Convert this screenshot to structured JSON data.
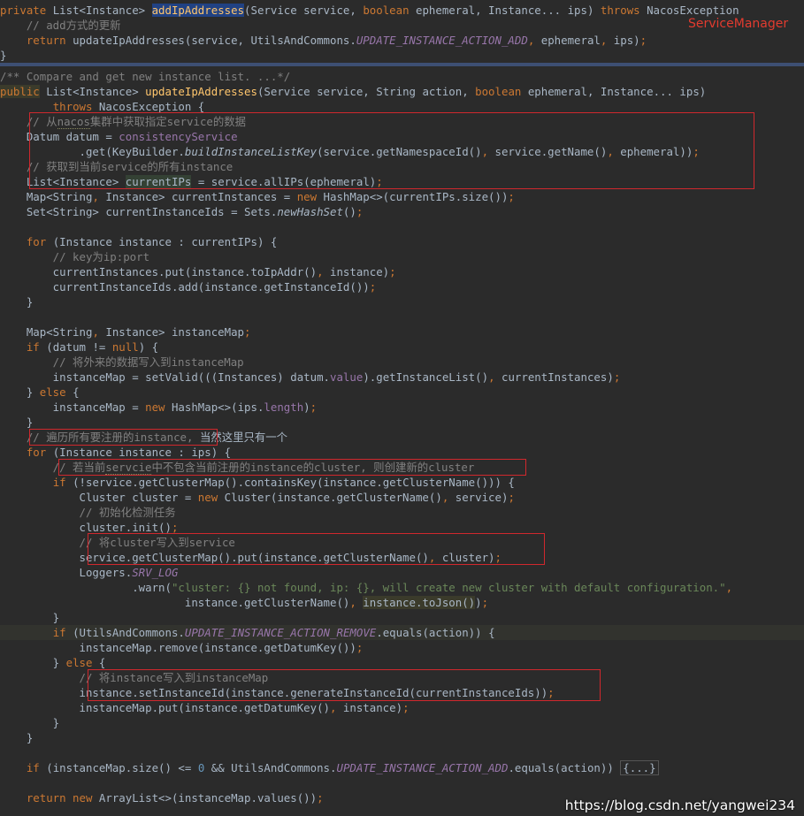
{
  "annotation": {
    "label": "ServiceManager",
    "color": "#e23b2f"
  },
  "watermark": "https://blog.csdn.net/yangwei234",
  "colors": {
    "background": "#2b2b2b",
    "keyword": "#cc7832",
    "method": "#ffc66d",
    "comment": "#808080",
    "field": "#9876aa",
    "string": "#6a8759",
    "number": "#6897bb",
    "box": "#d0282d"
  },
  "code": {
    "l01": [
      {
        "t": "private ",
        "c": "k"
      },
      {
        "t": "List<Instance> "
      },
      {
        "t": "addIpAddresses",
        "c": "f hl1"
      },
      {
        "t": "(Service service, "
      },
      {
        "t": "boolean ",
        "c": "k"
      },
      {
        "t": "ephemeral, Instance... ips) "
      },
      {
        "t": "throws ",
        "c": "k"
      },
      {
        "t": "NacosException"
      }
    ],
    "l02": [
      {
        "t": "    // add方式的更新",
        "c": "c"
      }
    ],
    "l03": [
      {
        "t": "    "
      },
      {
        "t": "return ",
        "c": "k"
      },
      {
        "t": "updateIpAddresses(service, UtilsAndCommons."
      },
      {
        "t": "UPDATE_INSTANCE_ACTION_ADD",
        "c": "pi"
      },
      {
        "t": ", ",
        "c": "k"
      },
      {
        "t": "ephemeral"
      },
      {
        "t": ", ",
        "c": "k"
      },
      {
        "t": "ips)"
      },
      {
        "t": ";",
        "c": "k"
      }
    ],
    "l04": [
      {
        "t": "}"
      }
    ],
    "l05": [
      {
        "t": "/** Compare and get new instance list. ...*/",
        "c": "c"
      }
    ],
    "l06": [
      {
        "t": "public",
        "c": "k hl3"
      },
      {
        "t": " List<Instance> "
      },
      {
        "t": "updateIpAddresses",
        "c": "f"
      },
      {
        "t": "(Service service, String action, "
      },
      {
        "t": "boolean ",
        "c": "k"
      },
      {
        "t": "ephemeral, Instance... ips)"
      }
    ],
    "l07": [
      {
        "t": "        "
      },
      {
        "t": "throws ",
        "c": "k"
      },
      {
        "t": "NacosException {"
      }
    ],
    "l08": [
      {
        "t": "    // 从",
        "c": "c"
      },
      {
        "t": "nacos",
        "c": "c warn"
      },
      {
        "t": "集群中获取指定service的数据",
        "c": "c"
      }
    ],
    "l09": [
      {
        "t": "    Datum datum = "
      },
      {
        "t": "consistencyService",
        "c": "p"
      }
    ],
    "l10": [
      {
        "t": "            .get(KeyBuilder."
      },
      {
        "t": "buildInstanceListKey",
        "c": "st"
      },
      {
        "t": "(service.getNamespaceId()"
      },
      {
        "t": ", ",
        "c": "k"
      },
      {
        "t": "service.getName()"
      },
      {
        "t": ", ",
        "c": "k"
      },
      {
        "t": "ephemeral))"
      },
      {
        "t": ";",
        "c": "k"
      }
    ],
    "l11": [
      {
        "t": "    // 获取到当前service的所有instance",
        "c": "c"
      }
    ],
    "l12": [
      {
        "t": "    List<Instance> "
      },
      {
        "t": "currentIPs",
        "c": "hl2"
      },
      {
        "t": " = service.allIPs(ephemeral)"
      },
      {
        "t": ";",
        "c": "k"
      }
    ],
    "l13": [
      {
        "t": "    Map<String"
      },
      {
        "t": ", ",
        "c": "k"
      },
      {
        "t": "Instance> currentInstances = "
      },
      {
        "t": "new ",
        "c": "k"
      },
      {
        "t": "HashMap<>(currentIPs.size())"
      },
      {
        "t": ";",
        "c": "k"
      }
    ],
    "l14": [
      {
        "t": "    Set<String> currentInstanceIds = Sets."
      },
      {
        "t": "newHashSet",
        "c": "st"
      },
      {
        "t": "()"
      },
      {
        "t": ";",
        "c": "k"
      }
    ],
    "l15": [],
    "l16": [
      {
        "t": "    "
      },
      {
        "t": "for ",
        "c": "k"
      },
      {
        "t": "(Instance instance : currentIPs) {"
      }
    ],
    "l17": [
      {
        "t": "        // key为ip:port",
        "c": "c"
      }
    ],
    "l18": [
      {
        "t": "        currentInstances.put(instance.toIpAddr()"
      },
      {
        "t": ", ",
        "c": "k"
      },
      {
        "t": "instance)"
      },
      {
        "t": ";",
        "c": "k"
      }
    ],
    "l19": [
      {
        "t": "        currentInstanceIds.add(instance.getInstanceId())"
      },
      {
        "t": ";",
        "c": "k"
      }
    ],
    "l20": [
      {
        "t": "    }"
      }
    ],
    "l21": [],
    "l22": [
      {
        "t": "    Map<String"
      },
      {
        "t": ", ",
        "c": "k"
      },
      {
        "t": "Instance> instanceMap"
      },
      {
        "t": ";",
        "c": "k"
      }
    ],
    "l23": [
      {
        "t": "    "
      },
      {
        "t": "if ",
        "c": "k"
      },
      {
        "t": "(datum != "
      },
      {
        "t": "null",
        "c": "k"
      },
      {
        "t": ") {"
      }
    ],
    "l24": [
      {
        "t": "        // 将外来的数据写入到instanceMap",
        "c": "c"
      }
    ],
    "l25": [
      {
        "t": "        instanceMap = setValid(((Instances) datum."
      },
      {
        "t": "value",
        "c": "p"
      },
      {
        "t": ").getInstanceList()"
      },
      {
        "t": ", ",
        "c": "k"
      },
      {
        "t": "currentInstances)"
      },
      {
        "t": ";",
        "c": "k"
      }
    ],
    "l26": [
      {
        "t": "    } "
      },
      {
        "t": "else ",
        "c": "k"
      },
      {
        "t": "{"
      }
    ],
    "l27": [
      {
        "t": "        instanceMap = "
      },
      {
        "t": "new ",
        "c": "k"
      },
      {
        "t": "HashMap<>(ips."
      },
      {
        "t": "length",
        "c": "p"
      },
      {
        "t": ")"
      },
      {
        "t": ";",
        "c": "k"
      }
    ],
    "l28": [
      {
        "t": "    }"
      }
    ],
    "l29": [
      {
        "t": "    // 遍历所有要注册的instance, ",
        "c": "c"
      },
      {
        "t": "当然这里只有一个"
      }
    ],
    "l30": [
      {
        "t": "    "
      },
      {
        "t": "for ",
        "c": "k"
      },
      {
        "t": "(Instance instance : ips) {"
      }
    ],
    "l31": [
      {
        "t": "        // 若当前",
        "c": "c"
      },
      {
        "t": "servcie",
        "c": "c warn"
      },
      {
        "t": "中不包含当前注册的instance的cluster, 则创建新的cluster",
        "c": "c"
      }
    ],
    "l32": [
      {
        "t": "        "
      },
      {
        "t": "if ",
        "c": "k"
      },
      {
        "t": "(!service.getClusterMap().containsKey(instance.getClusterName())) {"
      }
    ],
    "l33": [
      {
        "t": "            Cluster cluster = "
      },
      {
        "t": "new ",
        "c": "k"
      },
      {
        "t": "Cluster(instance.getClusterName()"
      },
      {
        "t": ", ",
        "c": "k"
      },
      {
        "t": "service)"
      },
      {
        "t": ";",
        "c": "k"
      }
    ],
    "l34": [
      {
        "t": "            // 初始化检测任务",
        "c": "c"
      }
    ],
    "l35": [
      {
        "t": "            cluster.init()"
      },
      {
        "t": ";",
        "c": "k"
      }
    ],
    "l36": [
      {
        "t": "            // 将cluster写入到service",
        "c": "c"
      }
    ],
    "l37": [
      {
        "t": "            service.getClusterMap().put(instance.getClusterName()"
      },
      {
        "t": ", ",
        "c": "k"
      },
      {
        "t": "cluster)"
      },
      {
        "t": ";",
        "c": "k"
      }
    ],
    "l38": [
      {
        "t": "            Loggers."
      },
      {
        "t": "SRV_LOG",
        "c": "pi"
      }
    ],
    "l39": [
      {
        "t": "                    .warn("
      },
      {
        "t": "\"cluster: {} not found, ip: {}, will create new cluster with default configuration.\"",
        "c": "s"
      },
      {
        "t": ",",
        "c": "k"
      }
    ],
    "l40": [
      {
        "t": "                            instance.getClusterName()"
      },
      {
        "t": ", ",
        "c": "k"
      },
      {
        "t": "instance.toJson()",
        "c": "hl3"
      },
      {
        "t": ")"
      },
      {
        "t": ";",
        "c": "k"
      }
    ],
    "l41": [
      {
        "t": "        }"
      }
    ],
    "l42": [
      {
        "t": "        "
      },
      {
        "t": "if ",
        "c": "k"
      },
      {
        "t": "(UtilsAndCommons."
      },
      {
        "t": "UPDATE_INSTANCE_ACTION_REMOVE",
        "c": "pi"
      },
      {
        "t": ".equals(action)) {"
      }
    ],
    "l43": [
      {
        "t": "            instanceMap.remove(instance.getDatumKey())"
      },
      {
        "t": ";",
        "c": "k"
      }
    ],
    "l44": [
      {
        "t": "        } "
      },
      {
        "t": "else ",
        "c": "k"
      },
      {
        "t": "{"
      }
    ],
    "l45": [
      {
        "t": "            // 将instance写入到instanceMap",
        "c": "c"
      }
    ],
    "l46": [
      {
        "t": "            instance.setInstanceId(instance.generateInstanceId(currentInstanceIds))"
      },
      {
        "t": ";",
        "c": "k"
      }
    ],
    "l47": [
      {
        "t": "            instanceMap.put(instance.getDatumKey()"
      },
      {
        "t": ", ",
        "c": "k"
      },
      {
        "t": "instance)"
      },
      {
        "t": ";",
        "c": "k"
      }
    ],
    "l48": [
      {
        "t": "        }"
      }
    ],
    "l49": [
      {
        "t": "    }"
      }
    ],
    "l50": [],
    "l51": [
      {
        "t": "    "
      },
      {
        "t": "if ",
        "c": "k"
      },
      {
        "t": "(instanceMap.size() <= "
      },
      {
        "t": "0 ",
        "c": "n"
      },
      {
        "t": "&& UtilsAndCommons."
      },
      {
        "t": "UPDATE_INSTANCE_ACTION_ADD",
        "c": "pi"
      },
      {
        "t": ".equals(action)) "
      },
      {
        "t": "{...}",
        "c": "fold"
      }
    ],
    "l52": [],
    "l53": [
      {
        "t": "    "
      },
      {
        "t": "return new ",
        "c": "k"
      },
      {
        "t": "ArrayList<>(instanceMap.values())"
      },
      {
        "t": ";",
        "c": "k"
      }
    ]
  }
}
